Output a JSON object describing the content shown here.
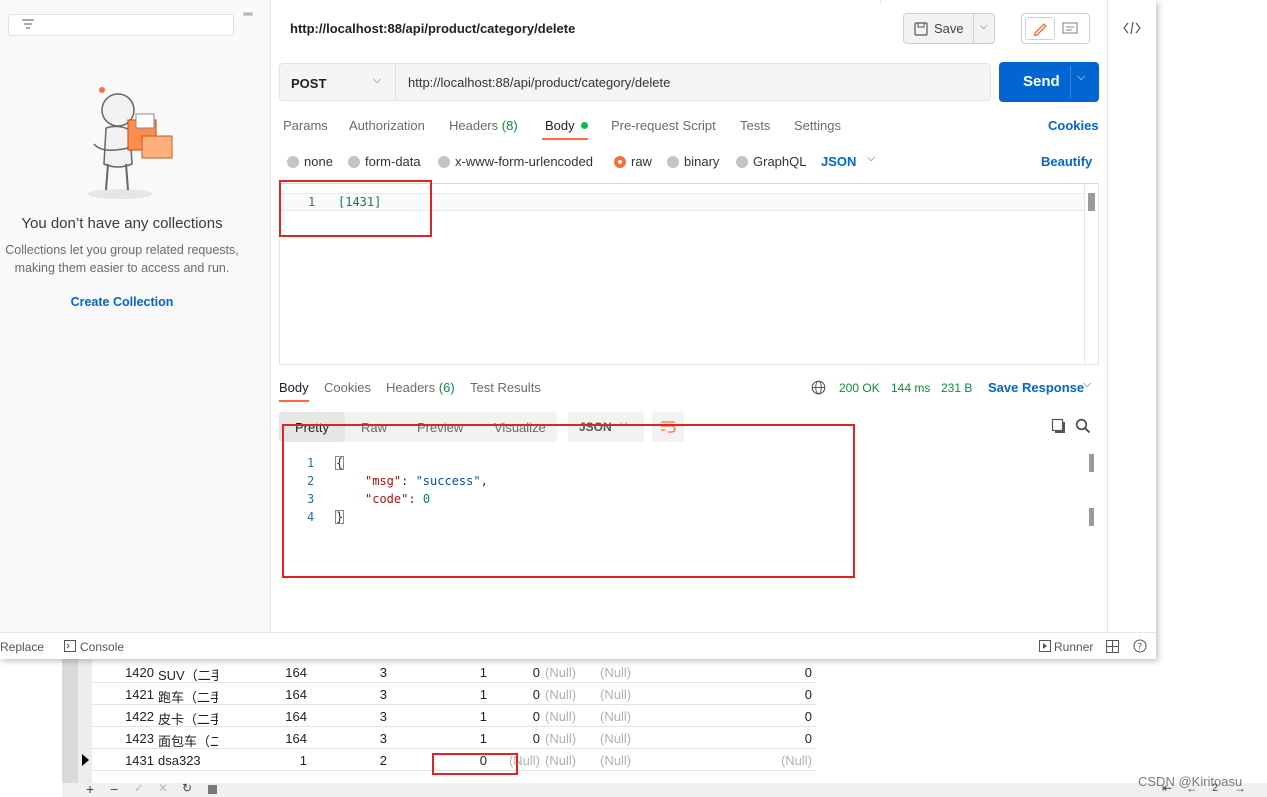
{
  "sidebar": {
    "empty_title": "You don’t have any collections",
    "empty_desc_line1": "Collections let you group related requests,",
    "empty_desc_line2": "making them easier to access and run.",
    "create_collection": "Create Collection",
    "menu_dots": "°°°"
  },
  "header": {
    "request_name": "http://localhost:88/api/product/category/delete",
    "save_label": "Save"
  },
  "request": {
    "method": "POST",
    "url": "http://localhost:88/api/product/category/delete",
    "send_label": "Send"
  },
  "request_tabs": {
    "params": "Params",
    "authorization": "Authorization",
    "headers": "Headers",
    "headers_count": "(8)",
    "body": "Body",
    "prerequest": "Pre-request Script",
    "tests": "Tests",
    "settings": "Settings",
    "cookies": "Cookies"
  },
  "body_options": {
    "none": "none",
    "form_data": "form-data",
    "urlencoded": "x-www-form-urlencoded",
    "raw": "raw",
    "binary": "binary",
    "graphql": "GraphQL",
    "format": "JSON",
    "beautify": "Beautify"
  },
  "request_body": {
    "line_number": "1",
    "code": "[1431]"
  },
  "response_tabs": {
    "body": "Body",
    "cookies": "Cookies",
    "headers": "Headers",
    "headers_count": "(6)",
    "test_results": "Test Results",
    "status": "200 OK",
    "time": "144 ms",
    "size": "231 B",
    "save_response": "Save Response"
  },
  "response_view": {
    "pretty": "Pretty",
    "raw": "Raw",
    "preview": "Preview",
    "visualize": "Visualize",
    "format": "JSON"
  },
  "response_body": {
    "lines": [
      {
        "num": "1",
        "text": "{"
      },
      {
        "num": "2",
        "key": "\"msg\"",
        "value": "\"success\"",
        "trail": ","
      },
      {
        "num": "3",
        "key": "\"code\"",
        "value": "0",
        "trail": ""
      },
      {
        "num": "4",
        "text": "}"
      }
    ]
  },
  "statusbar": {
    "replace": "Replace",
    "console": "Console",
    "runner": "Runner"
  },
  "db_table": {
    "rows": [
      {
        "id": "1420",
        "name": "SUV（二手",
        "c1": "164",
        "c2": "3",
        "c3": "1",
        "c4": "0",
        "c5": "(Null)",
        "c6": "(Null)",
        "c7": "0"
      },
      {
        "id": "1421",
        "name": "跑车（二手",
        "c1": "164",
        "c2": "3",
        "c3": "1",
        "c4": "0",
        "c5": "(Null)",
        "c6": "(Null)",
        "c7": "0"
      },
      {
        "id": "1422",
        "name": "皮卡（二手",
        "c1": "164",
        "c2": "3",
        "c3": "1",
        "c4": "0",
        "c5": "(Null)",
        "c6": "(Null)",
        "c7": "0"
      },
      {
        "id": "1423",
        "name": "面包车（二",
        "c1": "164",
        "c2": "3",
        "c3": "1",
        "c4": "0",
        "c5": "(Null)",
        "c6": "(Null)",
        "c7": "0"
      },
      {
        "id": "1431",
        "name": "dsa323",
        "c1": "1",
        "c2": "2",
        "c3": "0",
        "c4": "(Null)",
        "c5": "(Null)",
        "c6": "(Null)",
        "c7": "(Null)"
      }
    ]
  },
  "watermark": "CSDN @Kiritoasu",
  "page_number": "2",
  "colors": {
    "send_button": "#0265d2",
    "accent_orange": "#ff6c37",
    "status_green": "#0f8a3a",
    "annotation_red": "#e02424"
  },
  "icons": [
    "filter-icon",
    "save-icon",
    "edit-icon",
    "comment-icon",
    "code-icon",
    "globe-icon",
    "copy-icon",
    "search-icon",
    "wrap-icon",
    "console-icon",
    "runner-icon",
    "layout-icon",
    "help-icon"
  ]
}
